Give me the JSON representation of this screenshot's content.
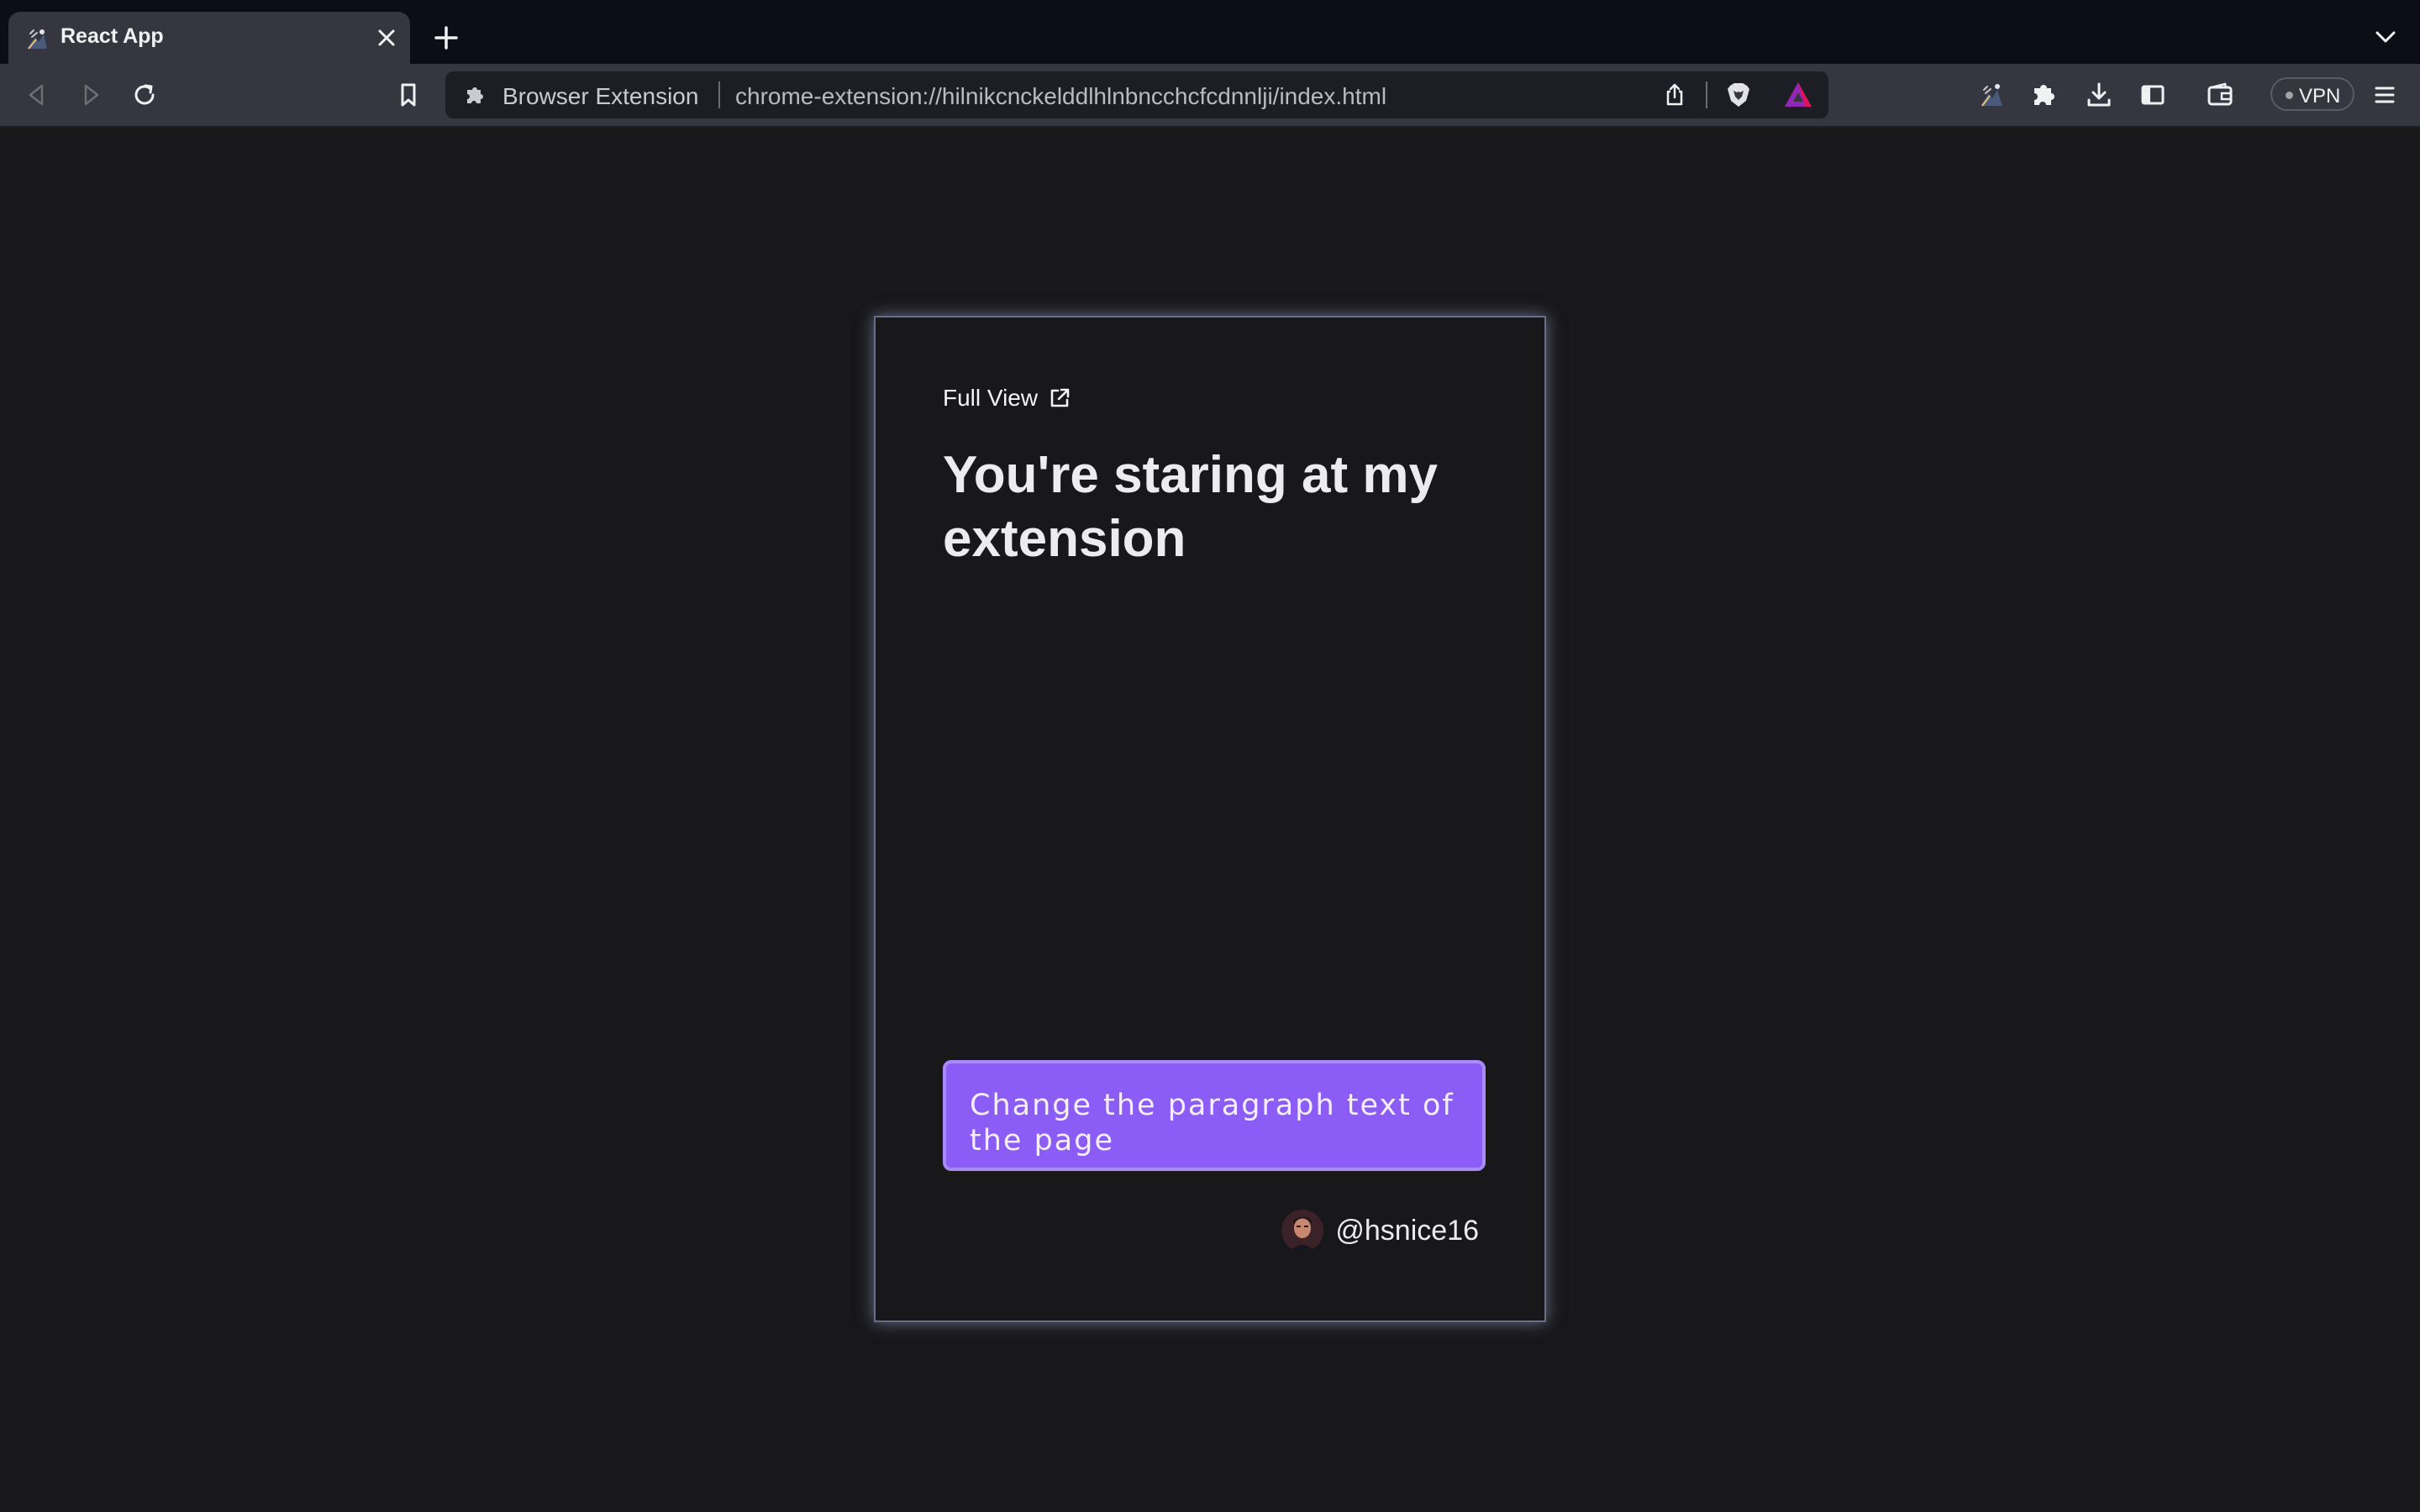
{
  "browser": {
    "tab": {
      "title": "React App",
      "favicon": "react-app-favicon-icon"
    },
    "omnibox": {
      "label": "Browser Extension",
      "url": "chrome-extension://hilnikcnckelddlhlnbncchcfcdnnlji/index.html"
    },
    "vpn_label": "VPN"
  },
  "extension": {
    "full_view_label": "Full View",
    "heading": "You're staring at my extension",
    "button_label": "Change the paragraph text of the page",
    "author_handle": "@hsnice16"
  },
  "colors": {
    "page_bg": "#18181b",
    "button_bg": "#8b5cf6",
    "button_border": "#a78bfa",
    "card_border": "#6a6d86"
  }
}
